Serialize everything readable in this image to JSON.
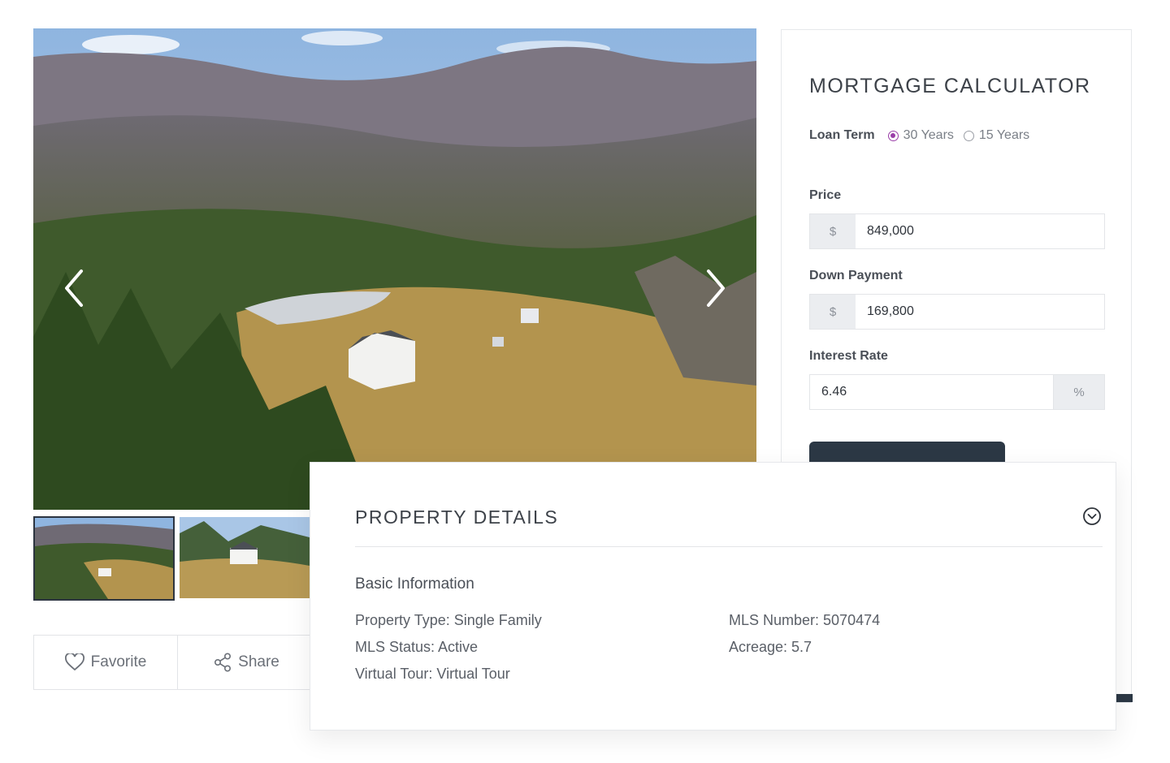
{
  "gallery": {
    "photo_alt": "Aerial view of farmhouse in wooded valley",
    "thumbs": [
      "thumbnail 1",
      "thumbnail 2"
    ]
  },
  "actions": {
    "favorite_label": "Favorite",
    "share_label": "Share"
  },
  "calculator": {
    "title": "MORTGAGE CALCULATOR",
    "loan_term_label": "Loan Term",
    "term_options": [
      "30 Years",
      "15 Years"
    ],
    "selected_term": "30 Years",
    "price_label": "Price",
    "price_prefix": "$",
    "price_value": "849,000",
    "down_label": "Down Payment",
    "down_prefix": "$",
    "down_value": "169,800",
    "rate_label": "Interest Rate",
    "rate_value": "6.46",
    "rate_suffix": "%"
  },
  "details": {
    "title": "PROPERTY DETAILS",
    "section": "Basic Information",
    "left": [
      "Property Type: Single Family",
      "MLS Status: Active",
      "Virtual Tour: Virtual Tour"
    ],
    "right": [
      "MLS Number: 5070474",
      "Acreage: 5.7"
    ]
  },
  "colors": {
    "accent": "#9a3da8",
    "button": "#2c3845",
    "border": "#e3e5e8"
  },
  "icons": [
    "chevron-left-icon",
    "chevron-right-icon",
    "heart-icon",
    "share-icon",
    "chevron-down-circle-icon"
  ]
}
